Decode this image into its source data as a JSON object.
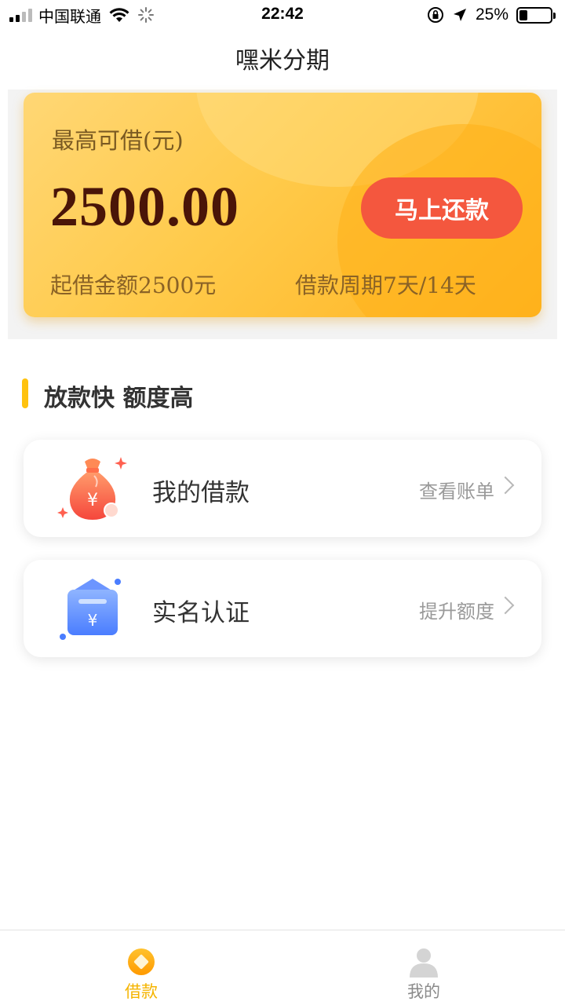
{
  "status_bar": {
    "carrier": "中国联通",
    "time": "22:42",
    "battery": "25%",
    "battery_level": 0.25
  },
  "nav": {
    "title": "嘿米分期"
  },
  "hero": {
    "label": "最高可借(元)",
    "amount": "2500.00",
    "button": "马上还款",
    "min_amount": "起借金额2500元",
    "period": "借款周期7天/14天"
  },
  "section": {
    "title": "放款快 额度高"
  },
  "list": [
    {
      "title": "我的借款",
      "link": "查看账单",
      "icon": "money-bag-icon"
    },
    {
      "title": "实名认证",
      "link": "提升额度",
      "icon": "wallet-icon"
    }
  ],
  "tabbar": {
    "tabs": [
      {
        "label": "借款",
        "icon": "coin-icon",
        "active": true
      },
      {
        "label": "我的",
        "icon": "user-icon",
        "active": false
      }
    ]
  },
  "colors": {
    "accent": "#ffc20e",
    "button": "#f4573e",
    "amount": "#4a1508"
  }
}
